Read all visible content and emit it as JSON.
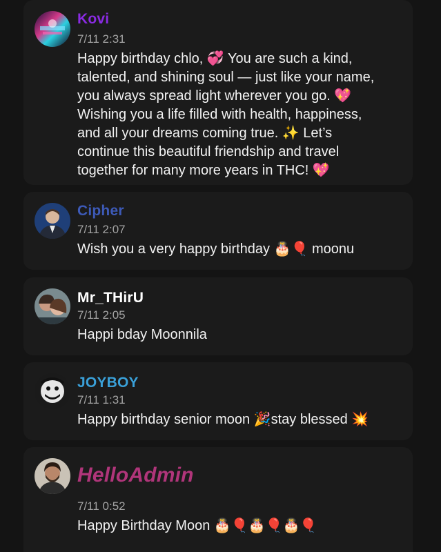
{
  "messages": [
    {
      "author": "Kovi",
      "name_color": "#8a2be2",
      "time": "7/11 2:31",
      "text": "Happy birthday chlo, 💞 You are such a kind,\ntalented, and shining soul — just like your name,\nyou always spread light wherever you go. 💖\nWishing you a life filled with health, happiness,\nand all your dreams coming true. ✨ Let’s\ncontinue this beautiful friendship and travel\ntogether for many more years in THC! 💖",
      "avatar_icon": "neon-art-avatar"
    },
    {
      "author": "Cipher",
      "name_color": "#3d5ab8",
      "time": "7/11 2:07",
      "text": "Wish you a very happy birthday 🎂🎈 moonu",
      "avatar_icon": "man-in-suit-avatar"
    },
    {
      "author": "Mr_THirU",
      "name_color": "#ffffff",
      "time": "7/11 2:05",
      "text": "Happi bday Moonnila",
      "avatar_icon": "couple-photo-avatar"
    },
    {
      "author": "JOYBOY",
      "name_color": "#3aa0d8",
      "time": "7/11 1:31",
      "text": "Happy birthday senior moon 🎉stay blessed 💥",
      "avatar_icon": "grinning-character-avatar"
    },
    {
      "author": "HelloAdmin",
      "name_color": "#b0357a",
      "time": "7/11 0:52",
      "text": "Happy Birthday Moon 🎂🎈🎂🎈🎂🎈",
      "avatar_icon": "bearded-man-avatar"
    }
  ]
}
